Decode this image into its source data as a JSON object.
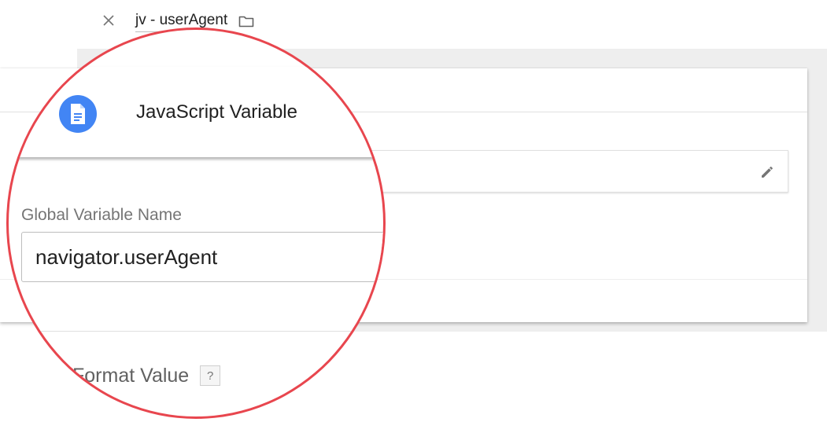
{
  "header": {
    "title": "jv - userAgent",
    "close_icon": "close-icon",
    "folder_icon": "folder-icon"
  },
  "variable_type": {
    "name": "JavaScript Variable",
    "icon": "document-icon",
    "icon_color": "#4285f4",
    "edit_icon": "pencil-icon"
  },
  "global_variable": {
    "label": "Global Variable Name",
    "value": "navigator.userAgent"
  },
  "format_value": {
    "label": "Format Value",
    "help": "?"
  },
  "colors": {
    "highlight_circle": "#e8464e",
    "background_gray": "#eeeeee"
  }
}
